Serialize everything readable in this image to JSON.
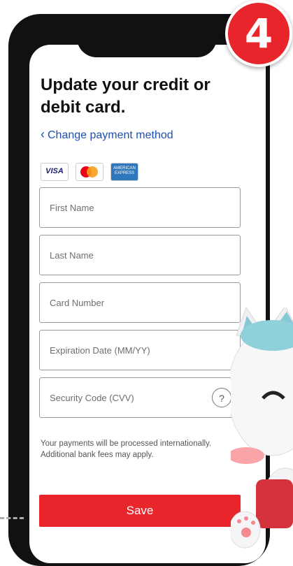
{
  "step_badge": "4",
  "form": {
    "title": "Update your credit or debit card.",
    "back_link": "Change payment method",
    "card_logos": {
      "visa": "VISA",
      "amex": "AMERICAN EXPRESS"
    },
    "fields": {
      "first_name_placeholder": "First Name",
      "last_name_placeholder": "Last Name",
      "card_number_placeholder": "Card Number",
      "expiration_placeholder": "Expiration Date (MM/YY)",
      "cvv_placeholder": "Security Code (CVV)",
      "cvv_help": "?"
    },
    "notice": "Your payments will be processed internationally. Additional bank fees may apply.",
    "save_label": "Save"
  },
  "colors": {
    "accent": "#e8252b",
    "link": "#1f4fb6",
    "phone": "#111111"
  }
}
